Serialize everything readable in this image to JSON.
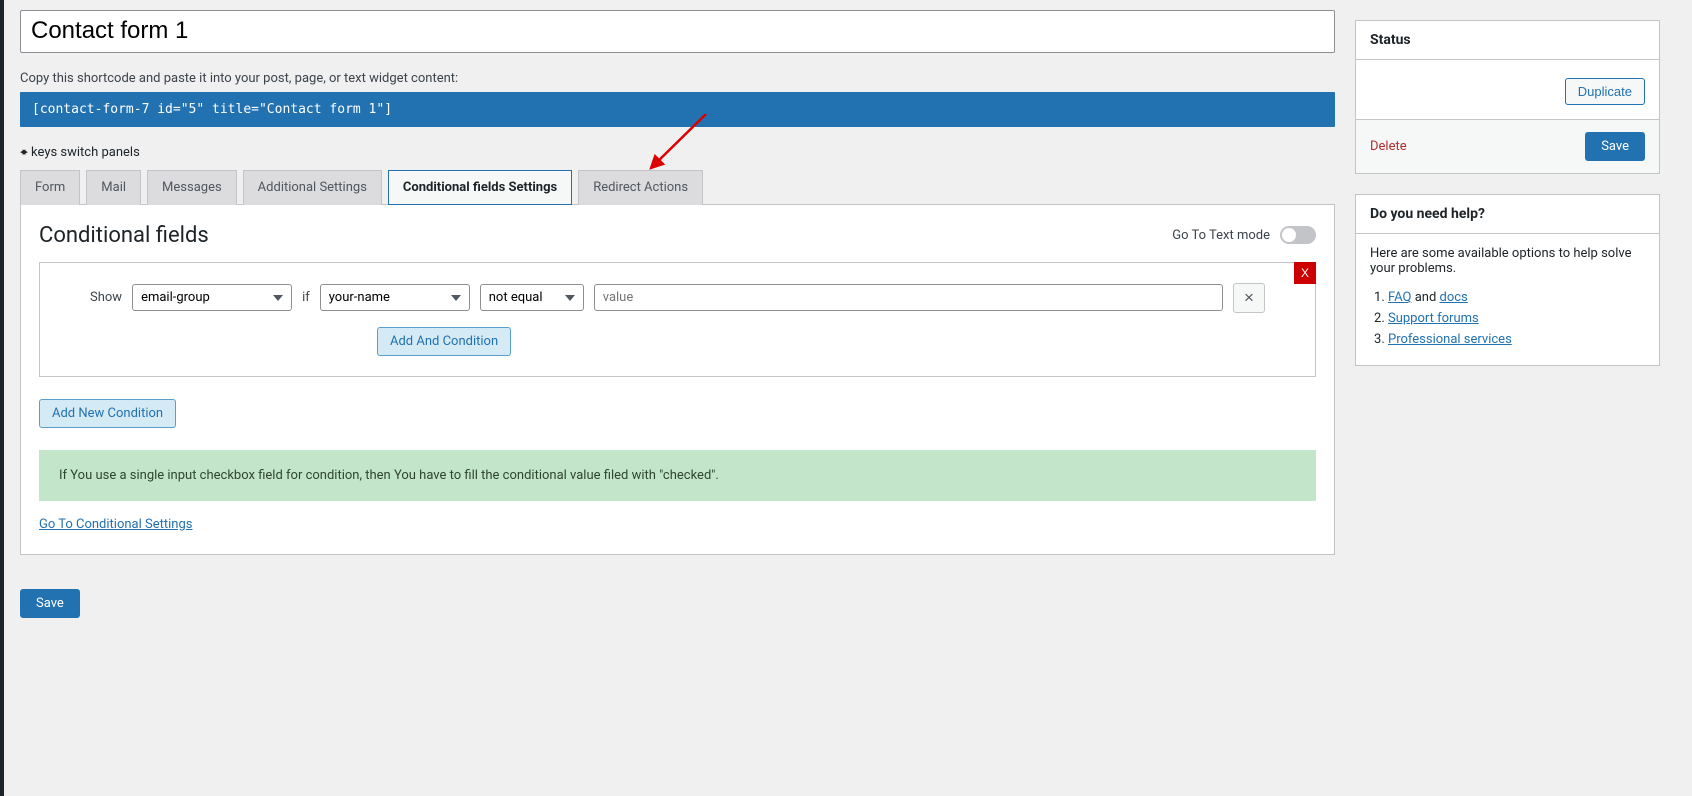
{
  "form_title": "Contact form 1",
  "hint": "Copy this shortcode and paste it into your post, page, or text widget content:",
  "shortcode": "[contact-form-7 id=\"5\" title=\"Contact form 1\"]",
  "switch_panels": "keys switch panels",
  "tabs": {
    "form": "Form",
    "mail": "Mail",
    "messages": "Messages",
    "additional": "Additional Settings",
    "conditional": "Conditional fields Settings",
    "redirect": "Redirect Actions"
  },
  "panel": {
    "title": "Conditional fields",
    "textmode_label": "Go To Text mode",
    "show_label": "Show",
    "if_label": "if",
    "group_value": "email-group",
    "field_value": "your-name",
    "op_value": "not equal",
    "value_placeholder": "value",
    "x": "X",
    "add_and": "Add And Condition",
    "add_new": "Add New Condition",
    "notice": "If You use a single input checkbox field for condition, then You have to fill the conditional value filed with \"checked\".",
    "goto_link": "Go To Conditional Settings"
  },
  "save_label": "Save",
  "status": {
    "title": "Status",
    "duplicate": "Duplicate",
    "delete": "Delete",
    "save": "Save"
  },
  "help": {
    "title": "Do you need help?",
    "intro": "Here are some available options to help solve your problems.",
    "faq": "FAQ",
    "and": " and ",
    "docs": "docs",
    "forums": "Support forums",
    "services": "Professional services"
  }
}
